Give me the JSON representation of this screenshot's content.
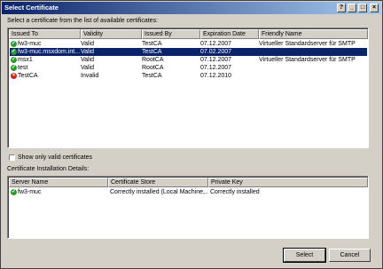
{
  "window": {
    "title": "Select Certificate",
    "controls": [
      "?",
      "_",
      "□",
      "×"
    ]
  },
  "prompt": "Select a certificate from the list of available certificates:",
  "cert_list": {
    "columns": [
      "Issued To",
      "Validity",
      "Issued By",
      "Expiration Date",
      "Friendly Name"
    ],
    "rows": [
      {
        "issued_to": "fw3-muc",
        "validity": "Valid",
        "issued_by": "TestCA",
        "expiration": "07.12.2007",
        "friendly_name": "Virtueller Standardserver für SMTP",
        "status": "ok"
      },
      {
        "issued_to": "fw3-muc.msxdom.int...",
        "validity": "Valid",
        "issued_by": "TestCA",
        "expiration": "07.02.2007",
        "friendly_name": "",
        "status": "ok"
      },
      {
        "issued_to": "msx1",
        "validity": "Valid",
        "issued_by": "RootCA",
        "expiration": "07.12.2007",
        "friendly_name": "Virtueller Standardserver für SMTP",
        "status": "ok"
      },
      {
        "issued_to": "test",
        "validity": "Valid",
        "issued_by": "RootCA",
        "expiration": "07.12.2007",
        "friendly_name": "",
        "status": "ok"
      },
      {
        "issued_to": "TestCA",
        "validity": "Invalid",
        "issued_by": "TestCA",
        "expiration": "07.12.2010",
        "friendly_name": "",
        "status": "bad"
      }
    ],
    "selected_index": 1
  },
  "show_valid_only": {
    "label": "Show only valid certificates",
    "checked": false
  },
  "details": {
    "label": "Certificate Installation Details:",
    "columns": [
      "Server Name",
      "Certificate Store",
      "Private Key"
    ],
    "rows": [
      {
        "server_name": "fw3-muc",
        "store": "Correctly installed (Local Machine,...",
        "private_key": "Correctly installed",
        "status": "ok"
      }
    ]
  },
  "buttons": {
    "select": "Select",
    "cancel": "Cancel"
  },
  "colors": {
    "selection": "#0a246a",
    "ok_icon": "#2e9a2e",
    "invalid_icon": "#d02020"
  }
}
